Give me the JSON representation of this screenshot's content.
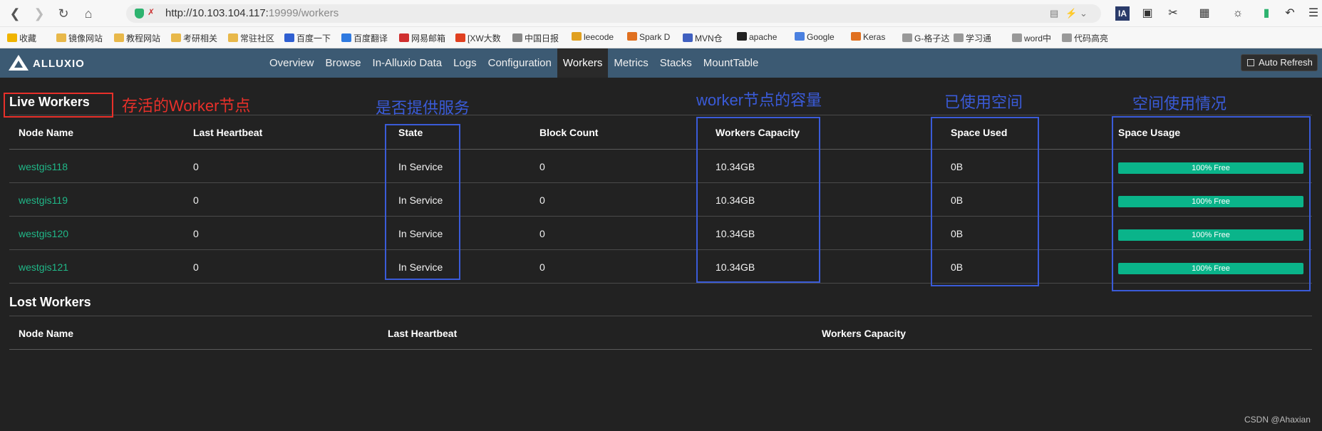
{
  "browser": {
    "url_host": "http://10.103.104.117:",
    "url_rest": "19999/workers"
  },
  "bookmarks": [
    {
      "label": "收藏",
      "color": "#f0b400"
    },
    {
      "label": "镜像网站",
      "color": "#e8b84a"
    },
    {
      "label": "教程网站",
      "color": "#e8b84a"
    },
    {
      "label": "考研相关",
      "color": "#e8b84a"
    },
    {
      "label": "常驻社区",
      "color": "#e8b84a"
    },
    {
      "label": "百度一下",
      "color": "#2f5fd1"
    },
    {
      "label": "百度翻译",
      "color": "#2f7ae0"
    },
    {
      "label": "网易邮箱",
      "color": "#d03030"
    },
    {
      "label": "[XW大数",
      "color": "#e04020"
    },
    {
      "label": "中国日报",
      "color": "#888888"
    },
    {
      "label": "leecode",
      "color": "#e0a020"
    },
    {
      "label": "Spark D",
      "color": "#e07020"
    },
    {
      "label": "MVN仓",
      "color": "#4060c0"
    },
    {
      "label": "apache",
      "color": "#222222"
    },
    {
      "label": "Google",
      "color": "#4a80e0"
    },
    {
      "label": "Keras",
      "color": "#e07020"
    },
    {
      "label": "G-格子达",
      "color": "#999999"
    },
    {
      "label": "学习通",
      "color": "#999999"
    },
    {
      "label": "word中",
      "color": "#999999"
    },
    {
      "label": "代码高亮",
      "color": "#999999"
    }
  ],
  "app": {
    "logo": "ALLUXIO",
    "tabs": [
      "Overview",
      "Browse",
      "In-Alluxio Data",
      "Logs",
      "Configuration",
      "Workers",
      "Metrics",
      "Stacks",
      "MountTable"
    ],
    "active_tab": "Workers",
    "auto_refresh": "Auto Refresh"
  },
  "live": {
    "title": "Live Workers",
    "headers": [
      "Node Name",
      "Last Heartbeat",
      "State",
      "Block Count",
      "Workers Capacity",
      "Space Used",
      "Space Usage"
    ],
    "rows": [
      {
        "node": "westgis118",
        "heartbeat": "0",
        "state": "In Service",
        "blocks": "0",
        "capacity": "10.34GB",
        "used": "0B",
        "usage": "100% Free",
        "free_pct": 100
      },
      {
        "node": "westgis119",
        "heartbeat": "0",
        "state": "In Service",
        "blocks": "0",
        "capacity": "10.34GB",
        "used": "0B",
        "usage": "100% Free",
        "free_pct": 100
      },
      {
        "node": "westgis120",
        "heartbeat": "0",
        "state": "In Service",
        "blocks": "0",
        "capacity": "10.34GB",
        "used": "0B",
        "usage": "100% Free",
        "free_pct": 100
      },
      {
        "node": "westgis121",
        "heartbeat": "0",
        "state": "In Service",
        "blocks": "0",
        "capacity": "10.34GB",
        "used": "0B",
        "usage": "100% Free",
        "free_pct": 100
      }
    ]
  },
  "lost": {
    "title": "Lost Workers",
    "headers": [
      "Node Name",
      "Last Heartbeat",
      "Workers Capacity"
    ]
  },
  "annotations": {
    "live": "存活的Worker节点",
    "state": "是否提供服务",
    "capacity": "worker节点的容量",
    "used": "已使用空间",
    "usage": "空间使用情况"
  },
  "colors": {
    "annotation_red": "#e8302a",
    "annotation_blue": "#3a5bd8",
    "accent_green": "#0ab48a"
  },
  "watermark": "CSDN @Ahaxian"
}
